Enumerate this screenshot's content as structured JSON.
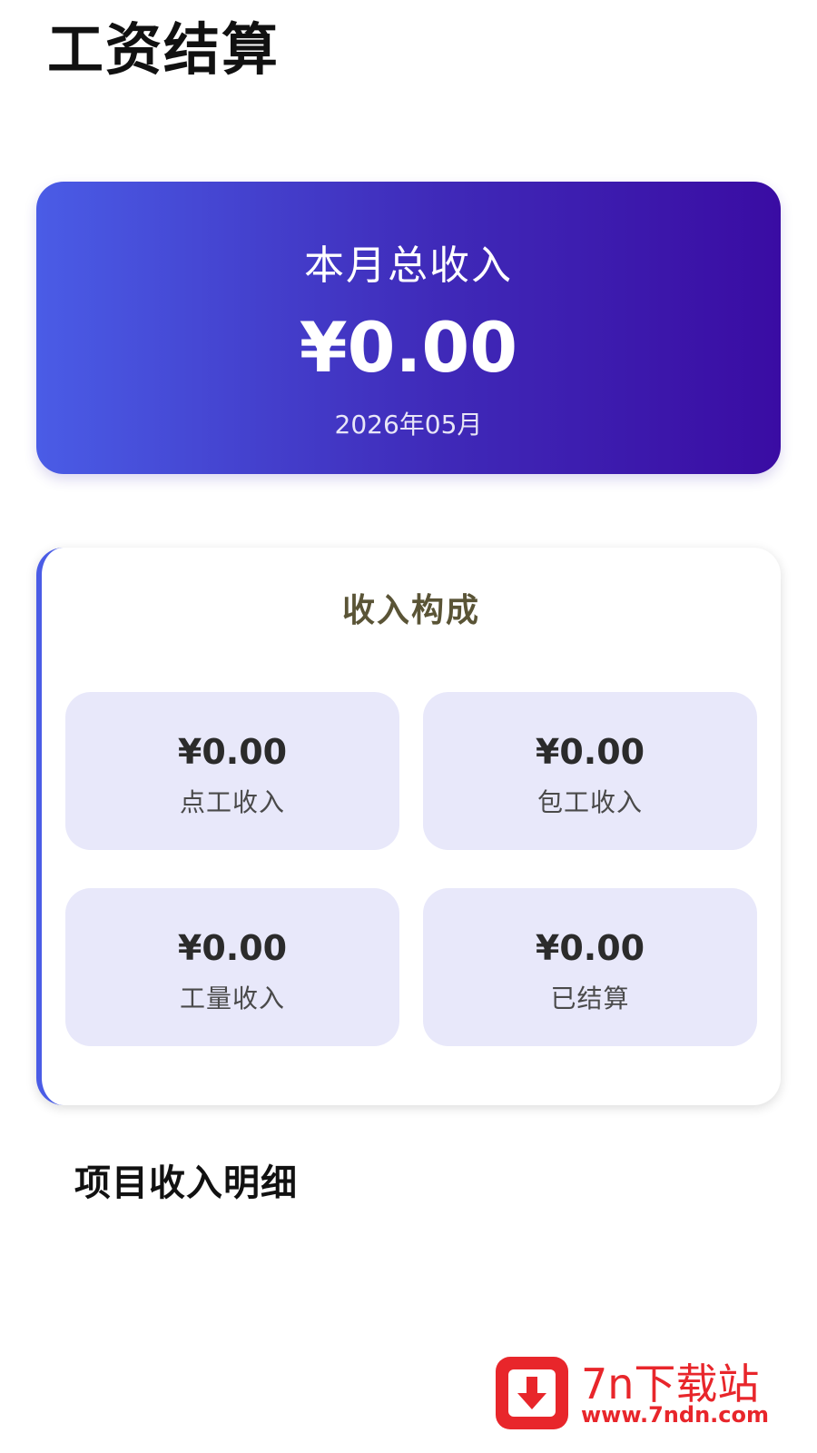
{
  "header": {
    "title": "工资结算"
  },
  "total_card": {
    "label": "本月总收入",
    "amount": "¥0.00",
    "month": "2026年05月"
  },
  "composition": {
    "title": "收入构成",
    "items": [
      {
        "value": "¥0.00",
        "label": "点工收入"
      },
      {
        "value": "¥0.00",
        "label": "包工收入"
      },
      {
        "value": "¥0.00",
        "label": "工量收入"
      },
      {
        "value": "¥0.00",
        "label": "已结算"
      }
    ]
  },
  "project_section": {
    "title": "项目收入明细"
  },
  "watermark": {
    "name": "7n下载站",
    "url": "www.7ndn.com",
    "icon": "download-arrow-icon"
  },
  "colors": {
    "gradient_start": "#4a5ce6",
    "gradient_end": "#3a0ca3",
    "tile_bg": "#e8e8fa",
    "accent": "#4a5ce6",
    "watermark_red": "#e8262b"
  }
}
